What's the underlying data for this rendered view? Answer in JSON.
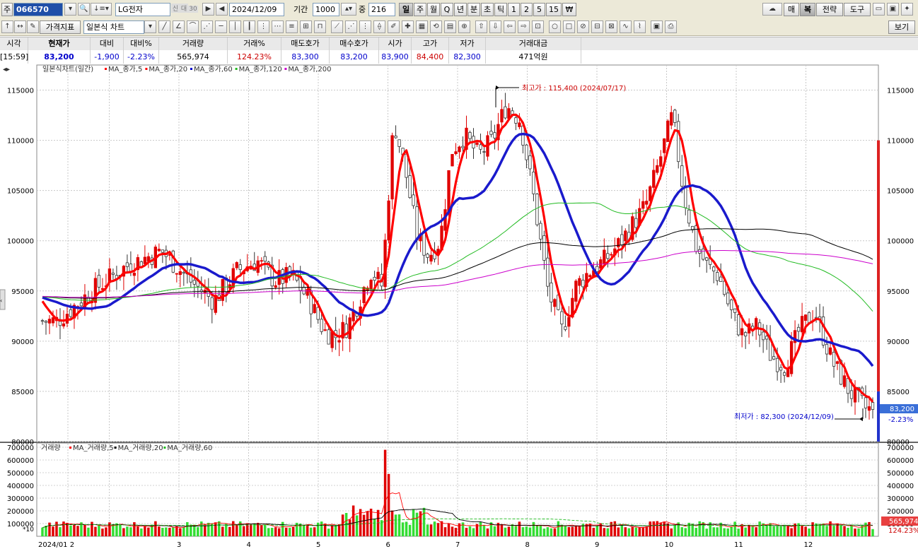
{
  "toolbar1": {
    "market_label": "주",
    "code": "066570",
    "name": "LG전자",
    "credit_badges": [
      "신",
      "대",
      "30"
    ],
    "date": "2024/12/09",
    "period_label": "기간",
    "period_value": "1000",
    "mid_label": "중",
    "mid_value": "216",
    "timeframes": [
      "일",
      "주",
      "월",
      "Q",
      "년",
      "분",
      "초",
      "틱",
      "1",
      "2",
      "5",
      "15",
      "₩"
    ],
    "active_timeframe": "일",
    "right_buttons": [
      "매",
      "복",
      "전략",
      "도구"
    ]
  },
  "toolbar2": {
    "price_indicator_label": "가격지표",
    "chart_type": "일본식 차트",
    "view_button": "보기"
  },
  "quote": {
    "headers": [
      "시각",
      "현재가",
      "대비",
      "대비%",
      "거래량",
      "거래%",
      "매도호가",
      "매수호가",
      "시가",
      "고가",
      "저가",
      "거래대금"
    ],
    "values": [
      "[15:59]",
      "83,200",
      "-1,900",
      "-2.23%",
      "565,974",
      "124.23%",
      "83,300",
      "83,200",
      "83,900",
      "84,400",
      "82,300",
      "471억원"
    ]
  },
  "price_panel": {
    "legend_title": "일본식차트(일간)",
    "legend": [
      {
        "name": "MA_종가,5",
        "color": "#ff0000"
      },
      {
        "name": "MA_종가,20",
        "color": "#ff0000"
      },
      {
        "name": "MA_종가,60",
        "color": "#0000cc"
      },
      {
        "name": "MA_종가,120",
        "color": "#22bb22"
      },
      {
        "name": "MA_종가,200",
        "color": "#cc00cc"
      }
    ],
    "y_ticks": [
      "115000",
      "110000",
      "105000",
      "100000",
      "95000",
      "90000",
      "85000",
      "80000"
    ],
    "high_annotation": "최고가 : 115,400 (2024/07/17)",
    "low_annotation": "최저가 : 82,300 (2024/12/09)",
    "current_price_tag": "83,200",
    "current_change_tag": "-2.23%"
  },
  "volume_panel": {
    "legend_title": "거래량",
    "legend": [
      {
        "name": "MA_거래량,5",
        "color": "#ff0000"
      },
      {
        "name": "MA_거래량,20",
        "color": "#000000"
      },
      {
        "name": "MA_거래량,60",
        "color": "#22bb22"
      }
    ],
    "y_ticks": [
      "700000",
      "600000",
      "500000",
      "400000",
      "300000",
      "200000",
      "100000"
    ],
    "unit_label": "*10",
    "current_volume_tag": "565,974",
    "current_volume_pct_tag": "124.23%"
  },
  "x_axis": {
    "labels": [
      "2024/01",
      "2",
      "3",
      "4",
      "5",
      "6",
      "7",
      "8",
      "9",
      "10",
      "11",
      "12"
    ]
  },
  "chart_data": {
    "type": "candlestick",
    "title": "일본식차트(일간)",
    "y_range": [
      80000,
      117500
    ],
    "months": [
      "2024/01",
      "2",
      "3",
      "4",
      "5",
      "6",
      "7",
      "8",
      "9",
      "10",
      "11",
      "12"
    ],
    "close_path": [
      [
        "2024/01",
        92000
      ],
      [
        "2024/01",
        95000
      ],
      [
        "2",
        97500
      ],
      [
        "2",
        99000
      ],
      [
        "3",
        96000
      ],
      [
        "3",
        94000
      ],
      [
        "3",
        97000
      ],
      [
        "4",
        98000
      ],
      [
        "4",
        96000
      ],
      [
        "4",
        96500
      ],
      [
        "4",
        94000
      ],
      [
        "5",
        91000
      ],
      [
        "5",
        90500
      ],
      [
        "5",
        91500
      ],
      [
        "5",
        94000
      ],
      [
        "5",
        97000
      ],
      [
        "5",
        95500
      ],
      [
        "6",
        112000
      ],
      [
        "6",
        107000
      ],
      [
        "6",
        100500
      ],
      [
        "6",
        98500
      ],
      [
        "6",
        100000
      ],
      [
        "6",
        109000
      ],
      [
        "7",
        110500
      ],
      [
        "7",
        108500
      ],
      [
        "7",
        110000
      ],
      [
        "7",
        113500
      ],
      [
        "7",
        112000
      ],
      [
        "8",
        104000
      ],
      [
        "8",
        95000
      ],
      [
        "8",
        91000
      ],
      [
        "8",
        95500
      ],
      [
        "8",
        97000
      ],
      [
        "9",
        98000
      ],
      [
        "9",
        99500
      ],
      [
        "9",
        101500
      ],
      [
        "9",
        103500
      ],
      [
        "9",
        108000
      ],
      [
        "10",
        112500
      ],
      [
        "10",
        104500
      ],
      [
        "10",
        99500
      ],
      [
        "10",
        97500
      ],
      [
        "10",
        96500
      ],
      [
        "10",
        93000
      ],
      [
        "11",
        90500
      ],
      [
        "11",
        91500
      ],
      [
        "11",
        88500
      ],
      [
        "11",
        87500
      ],
      [
        "11",
        91000
      ],
      [
        "12",
        93000
      ],
      [
        "12",
        88000
      ],
      [
        "12",
        85000
      ],
      [
        "12",
        83200
      ]
    ],
    "volume_spike": {
      "month": "5",
      "value": 680000
    },
    "volume_y_range": [
      0,
      700000
    ],
    "high": {
      "price": 115400,
      "date": "2024/07/17"
    },
    "low": {
      "price": 82300,
      "date": "2024/12/09"
    },
    "last": {
      "price": 83200,
      "change_pct": "-2.23%",
      "volume": 565974
    }
  }
}
